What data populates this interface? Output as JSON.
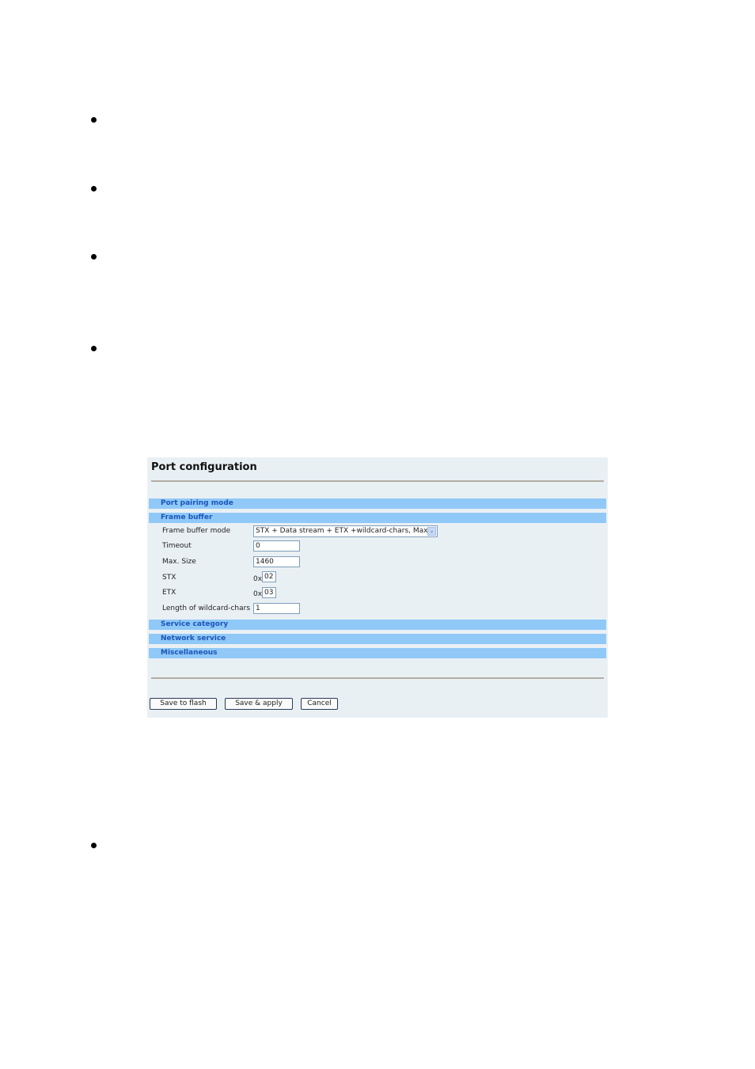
{
  "panel": {
    "title": "Port configuration",
    "sections": {
      "port_pairing": "Port pairing mode",
      "frame_buffer": "Frame buffer",
      "service_category": "Service category",
      "network_service": "Network service",
      "miscellaneous": "Miscellaneous"
    },
    "fields": {
      "frame_buffer_mode": {
        "label": "Frame buffer mode",
        "value": "STX + Data stream + ETX +wildcard-chars, Max"
      },
      "timeout": {
        "label": "Timeout",
        "value": "0"
      },
      "max_size": {
        "label": "Max. Size",
        "value": "1460"
      },
      "stx": {
        "label": "STX",
        "prefix": "0x",
        "value": "02"
      },
      "etx": {
        "label": "ETX",
        "prefix": "0x",
        "value": "03"
      },
      "wildcard_length": {
        "label": "Length of wildcard-chars",
        "value": "1"
      }
    },
    "buttons": {
      "save_flash": "Save to flash",
      "save_apply": "Save & apply",
      "cancel": "Cancel"
    },
    "select_arrow_icon": "⌄"
  },
  "colors": {
    "panel_bg": "#e9f0f4",
    "section_bg": "#90c8f8",
    "section_text": "#1a56b8"
  }
}
